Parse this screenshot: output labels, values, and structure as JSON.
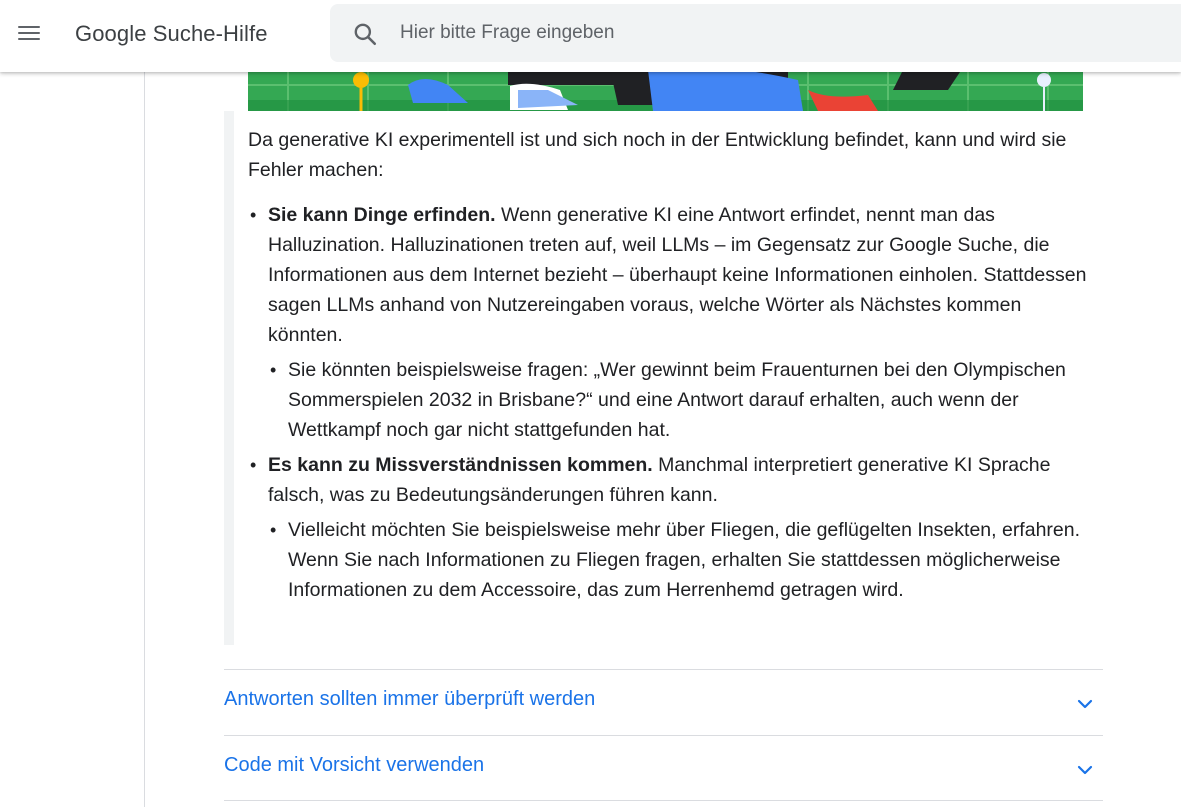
{
  "header": {
    "brand": "Google Suche-Hilfe",
    "search_placeholder": "Hier bitte Frage eingeben"
  },
  "article": {
    "intro": "Da generative KI experimentell ist und sich noch in der Entwicklung befindet, kann und wird sie Fehler machen:",
    "items": [
      {
        "bold": "Sie kann Dinge erfinden.",
        "text": " Wenn generative KI eine Antwort erfindet, nennt man das Halluzination. Halluzinationen treten auf, weil LLMs – im Gegensatz zur Google Suche, die Informationen aus dem Internet bezieht – überhaupt keine Informationen einholen. Stattdessen sagen LLMs anhand von Nutzereingaben voraus, welche Wörter als Nächstes kommen könnten.",
        "sub": "Sie könnten beispielsweise fragen: „Wer gewinnt beim Frauenturnen bei den Olympischen Sommerspielen 2032 in Brisbane?“ und eine Antwort darauf erhalten, auch wenn der Wettkampf noch gar nicht stattgefunden hat."
      },
      {
        "bold": "Es kann zu Missverständnissen kommen.",
        "text": " Manchmal interpretiert generative KI Sprache falsch, was zu Bedeutungsänderungen führen kann.",
        "sub": "Vielleicht möchten Sie beispielsweise mehr über Fliegen, die geflügelten Insekten, erfahren. Wenn Sie nach Informationen zu Fliegen fragen, erhalten Sie stattdessen möglicherweise Informationen zu dem Accessoire, das zum Herrenhemd getragen wird."
      }
    ]
  },
  "accordions": [
    {
      "title": "Antworten sollten immer überprüft werden",
      "icon": "chevron-down-icon"
    },
    {
      "title": "Code mit Vorsicht verwenden",
      "icon": "chevron-down-icon"
    }
  ],
  "colors": {
    "link": "#1a73e8",
    "illustration_green": "#34a853",
    "illustration_blue": "#4285f4"
  }
}
